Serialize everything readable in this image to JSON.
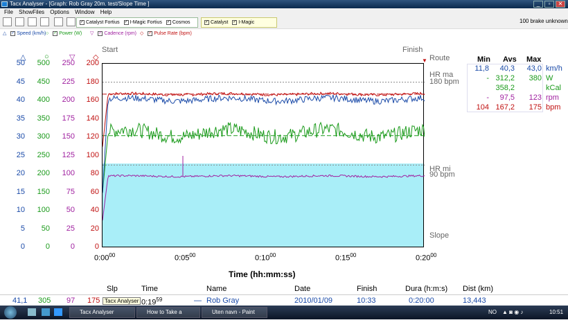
{
  "window": {
    "title": "Tacx Analyser - [Graph:  Rob Gray  20m. test/Slope Time ]"
  },
  "menu": [
    "File",
    "ShowFiles",
    "Options",
    "Window",
    "Help"
  ],
  "toolbar": {
    "group1": [
      "Catalyst Fortius",
      "I-Magic Fortius",
      "Cosmos"
    ],
    "group2": [
      "Catalyst",
      "I-Magic"
    ],
    "status": "100 brake unknown"
  },
  "legend": [
    "Speed (km/h)",
    "Power (W)",
    "Cadence (rpm)",
    "Pulse Rate (bpm)"
  ],
  "axes": {
    "speed": [
      "50",
      "45",
      "40",
      "35",
      "30",
      "25",
      "20",
      "15",
      "10",
      "5",
      "0"
    ],
    "power": [
      "500",
      "450",
      "400",
      "350",
      "300",
      "250",
      "200",
      "150",
      "100",
      "50",
      "0"
    ],
    "cadence": [
      "250",
      "225",
      "200",
      "175",
      "150",
      "125",
      "100",
      "75",
      "50",
      "25",
      "0"
    ],
    "pulse": [
      "200",
      "180",
      "160",
      "140",
      "120",
      "100",
      "80",
      "60",
      "40",
      "20",
      "0"
    ]
  },
  "markers": {
    "start": "Start",
    "finish": "Finish",
    "route": "Route",
    "hrmax": "HR ma",
    "hrmax_val": "180 bpm",
    "hrmin": "HR mi",
    "hrmin_val": "90 bpm",
    "slope": "Slope"
  },
  "xaxis": {
    "ticks": [
      "0:00",
      "0:05",
      "0:10",
      "0:15",
      "0:20"
    ],
    "sub": "00",
    "label": "Time (hh:mm:ss)"
  },
  "stats": {
    "headers": [
      "Min",
      "Avs",
      "Max"
    ],
    "rows": [
      {
        "min": "11,8",
        "avg": "40,3",
        "max": "43,0",
        "unit": "km/h",
        "color": "#1a4aa8"
      },
      {
        "min": "-",
        "avg": "312,2",
        "max": "380",
        "unit": "W",
        "color": "#1a9a1a"
      },
      {
        "min": "",
        "avg": "358,2",
        "max": "",
        "unit": "kCal",
        "color": "#1a9a1a"
      },
      {
        "min": "-",
        "avg": "97,5",
        "max": "123",
        "unit": "rpm",
        "color": "#a020a0"
      },
      {
        "min": "104",
        "avg": "167,2",
        "max": "175",
        "unit": "bpm",
        "color": "#c01010"
      }
    ]
  },
  "info": {
    "headers": {
      "slp": "Slp",
      "time": "Time",
      "name": "Name",
      "date": "Date",
      "finish": "Finish",
      "dura": "Dura (h:m:s)",
      "dist": "Dist (km)"
    },
    "values": {
      "speed": "41,1",
      "power": "305",
      "cadence": "97",
      "pulse": "175",
      "time": "0:19",
      "time_sec": "59",
      "dash": "—",
      "name": "Rob Gray",
      "date": "2010/01/09",
      "finish": "10:33",
      "dura": "0:20:00",
      "dist": "13,443"
    },
    "tooltip": "Tacx Analyser"
  },
  "taskbar": {
    "items": [
      "Tacx Analyser",
      "How to Take a Scree...",
      "Uten navn - Paint"
    ],
    "lang": "NO",
    "clock": "10:51"
  },
  "colors": {
    "speed": "#1a4aa8",
    "power": "#1a9a1a",
    "cadence": "#a020a0",
    "pulse": "#c01010",
    "slope": "#a9eef8"
  },
  "chart_data": {
    "type": "line",
    "x_range": [
      "0:00:00",
      "0:20:00"
    ],
    "series": [
      {
        "name": "Speed (km/h)",
        "approx_level": 40.3
      },
      {
        "name": "Power (W)",
        "approx_level": 312
      },
      {
        "name": "Cadence (rpm)",
        "approx_level": 97.5
      },
      {
        "name": "Pulse Rate (bpm)",
        "approx_level": 167
      }
    ]
  }
}
